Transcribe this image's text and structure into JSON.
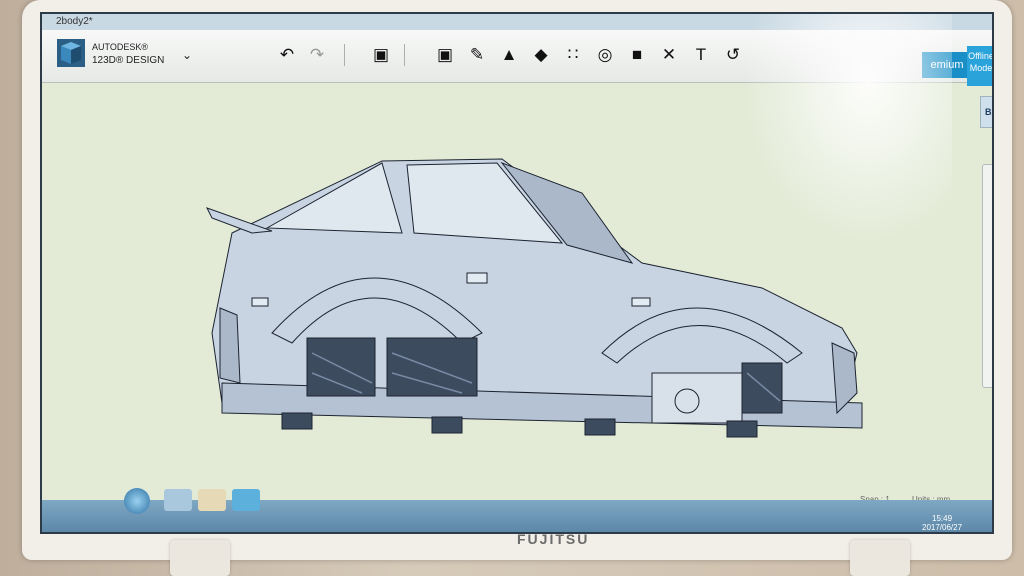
{
  "window": {
    "title": "2body2*"
  },
  "app": {
    "line1": "AUTODESK®",
    "line2": "123D® DESIGN",
    "menu_icon": "chevron-down-icon"
  },
  "toolbar": {
    "undo_icon": "undo-arrow-icon",
    "redo_icon": "redo-arrow-icon",
    "tools": [
      {
        "name": "primitives-tool",
        "glyph": "▣"
      },
      {
        "name": "sketch-tool",
        "glyph": "✎"
      },
      {
        "name": "construct-tool",
        "glyph": "▲"
      },
      {
        "name": "modify-tool",
        "glyph": "◆"
      },
      {
        "name": "pattern-tool",
        "glyph": "∷"
      },
      {
        "name": "grouping-tool",
        "glyph": "◎"
      },
      {
        "name": "combine-tool",
        "glyph": "■"
      },
      {
        "name": "measure-tool",
        "glyph": "✕"
      },
      {
        "name": "text-tool",
        "glyph": "T"
      },
      {
        "name": "snap-tool",
        "glyph": "↺"
      }
    ],
    "premium_label": "emium",
    "offline_label": "Offline Mode"
  },
  "right_panel": {
    "back_label": "BACK",
    "nav_icons": [
      "pan-icon",
      "orbit-icon",
      "zoom-icon",
      "fit-view-icon",
      "view-cube-icon",
      "visibility-icon",
      "grid-icon",
      "material-icon"
    ]
  },
  "status": {
    "snap": "Snap : 1",
    "units": "Units : mm"
  },
  "clock": {
    "time": "15:49",
    "date": "2017/06/27"
  },
  "laptop": {
    "brand": "FUJITSU"
  },
  "colors": {
    "model_fill": "#c8d4e2",
    "model_stroke": "#1c2330",
    "tire": "#3d4b5f",
    "accent": "#1a8fc7"
  }
}
